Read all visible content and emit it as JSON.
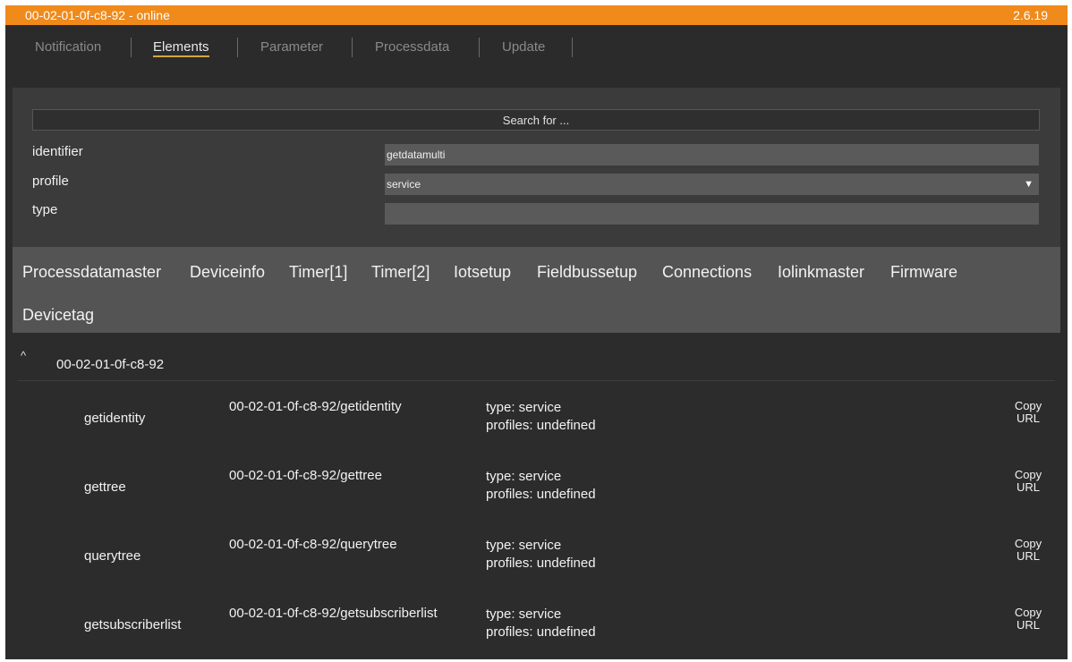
{
  "window": {
    "title": "00-02-01-0f-c8-92 - online",
    "version": "2.6.19"
  },
  "tabs": [
    {
      "label": "Notification",
      "active": false
    },
    {
      "label": "Elements",
      "active": true
    },
    {
      "label": "Parameter",
      "active": false
    },
    {
      "label": "Processdata",
      "active": false
    },
    {
      "label": "Update",
      "active": false
    }
  ],
  "search": {
    "button_label": "Search for ...",
    "fields": {
      "identifier": {
        "label": "identifier",
        "value": "getdatamulti"
      },
      "profile": {
        "label": "profile",
        "value": "service"
      },
      "type": {
        "label": "type",
        "value": ""
      }
    }
  },
  "categories": [
    "Processdatamaster",
    "Deviceinfo",
    "Timer[1]",
    "Timer[2]",
    "Iotsetup",
    "Fieldbussetup",
    "Connections",
    "Iolinkmaster",
    "Firmware",
    "Devicetag"
  ],
  "tree": {
    "toggle": "^",
    "root": "00-02-01-0f-c8-92",
    "copy_label_line1": "Copy",
    "copy_label_line2": "URL",
    "rows": [
      {
        "name": "getidentity",
        "path": "00-02-01-0f-c8-92/getidentity",
        "type": "type: service",
        "profiles": "profiles: undefined"
      },
      {
        "name": "gettree",
        "path": "00-02-01-0f-c8-92/gettree",
        "type": "type: service",
        "profiles": "profiles: undefined"
      },
      {
        "name": "querytree",
        "path": "00-02-01-0f-c8-92/querytree",
        "type": "type: service",
        "profiles": "profiles: undefined"
      },
      {
        "name": "getsubscriberlist",
        "path": "00-02-01-0f-c8-92/getsubscriberlist",
        "type": "type: service",
        "profiles": "profiles: undefined"
      }
    ]
  },
  "colors": {
    "accent": "#f08a1a",
    "tab_underline": "#d4a640",
    "background": "#2c2c2c"
  }
}
